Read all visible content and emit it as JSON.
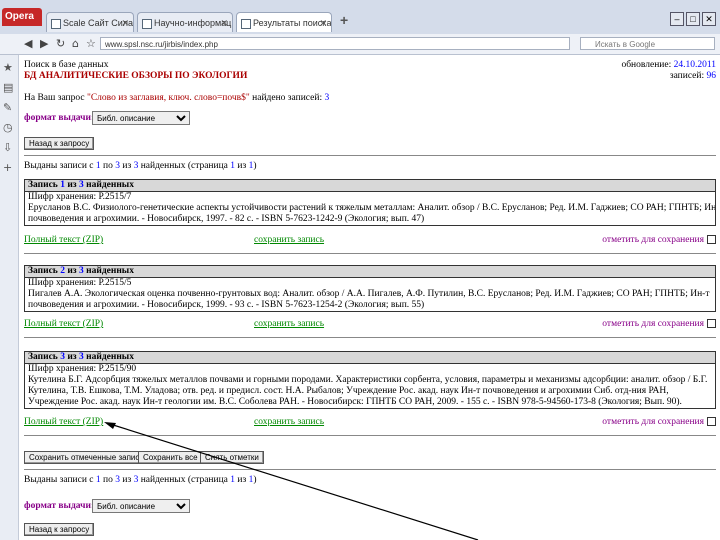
{
  "browser": {
    "logo": "Opera",
    "tabs": [
      {
        "label": "Scale Сайт Сила Ес Тон",
        "active": false
      },
      {
        "label": "Научно-информационный ресурс",
        "active": false
      },
      {
        "label": "Результаты поиска",
        "active": true
      }
    ],
    "new_tab": "+",
    "url": "www.spsl.nsc.ru/jirbis/index.php",
    "search_placeholder": "Искать в Google"
  },
  "page": {
    "search_title": "Поиск в базе данных",
    "db_title": "БД АНАЛИТИЧЕСКИЕ ОБЗОРЫ ПО ЭКОЛОГИИ",
    "update_label": "обновление:",
    "update_date": "24.10.2011",
    "records_label": "записей:",
    "records_count": "96",
    "query_prefix": "На Ваш запрос",
    "query_text": "\"Слово из заглавия, ключ. слово=почв$\"",
    "query_suffix": "найдено записей:",
    "found_count": "3",
    "format_label": "формат выдачи:",
    "format_value": "Библ. описание",
    "back_button": "Назад к запросу",
    "shown_prefix": "Выданы записи с",
    "shown_from": "1",
    "shown_to_word": "по",
    "shown_to": "3",
    "shown_of_word": "из",
    "shown_total": "3",
    "shown_found_word": "найденных (страница",
    "shown_page": "1",
    "shown_page_of": "из",
    "shown_pages": "1",
    "shown_close": ")"
  },
  "records": [
    {
      "header_prefix": "Запись",
      "num": "1",
      "of_word": "из",
      "total": "3",
      "found_word": "найденных",
      "lines": [
        "Шифр хранения: Р.2515/7",
        "Ерусланов В.С. Физиолого-генетические аспекты устойчивости растений к тяжелым металлам: Аналит. обзор / В.С. Ерусланов; Ред. И.М. Гаджиев; СО РАН; ГПНТБ; Ин-т",
        "почвоведения и агрохимии. - Новосибирск, 1997. - 82 с. - ISBN 5-7623-1242-9 (Экология; вып. 47)"
      ],
      "full_text": "Полный текст (ZIP)",
      "save": "сохранить запись",
      "mark": "отметить для сохранения"
    },
    {
      "header_prefix": "Запись",
      "num": "2",
      "of_word": "из",
      "total": "3",
      "found_word": "найденных",
      "lines": [
        "Шифр хранения: Р.2515/5",
        "Пигалев А.А. Экологическая оценка почвенно-грунтовых вод: Аналит. обзор / А.А. Пигалев, А.Ф. Путилин, В.С. Ерусланов; Ред. И.М. Гаджиев; СО РАН; ГПНТБ; Ин-т",
        "почвоведения и агрохимии. - Новосибирск, 1999. - 93 с. - ISBN 5-7623-1254-2 (Экология; вып. 55)"
      ],
      "full_text": "Полный текст (ZIP)",
      "save": "сохранить запись",
      "mark": "отметить для сохранения"
    },
    {
      "header_prefix": "Запись",
      "num": "3",
      "of_word": "из",
      "total": "3",
      "found_word": "найденных",
      "lines": [
        "Шифр хранения: Р.2515/90",
        "Кутелина Б.Г. Адсорбция тяжелых металлов почвами и горными породами. Характеристики сорбента, условия, параметры и механизмы адсорбции: аналит. обзор / Б.Г.",
        "Кутелина, Т.В. Ешкова, Т.М. Уладова; отв. ред. и предисл. сост. Н.А. Рыбалов; Учреждение Рос. акад. наук Ин-т почвоведения и агрохимии Сиб. отд-ния РАН,",
        "Учреждение Рос. акад. наук Ин-т геологии им. В.С. Соболева РАН. - Новосибирск: ГПНТБ СО РАН, 2009. - 155 с. - ISBN 978-5-94560-173-8 (Экология; Вып. 90)."
      ],
      "full_text": "Полный текст (ZIP)",
      "save": "сохранить запись",
      "mark": "отметить для сохранения"
    }
  ],
  "actions": {
    "save_marked": "Сохранить отмеченные записи",
    "save_all": "Сохранить все",
    "unmark": "Снять отметки"
  },
  "colors": {
    "link_green": "#008800",
    "link_blue": "#0000ff",
    "title_red": "#aa0000",
    "mark_purple": "#880088"
  }
}
